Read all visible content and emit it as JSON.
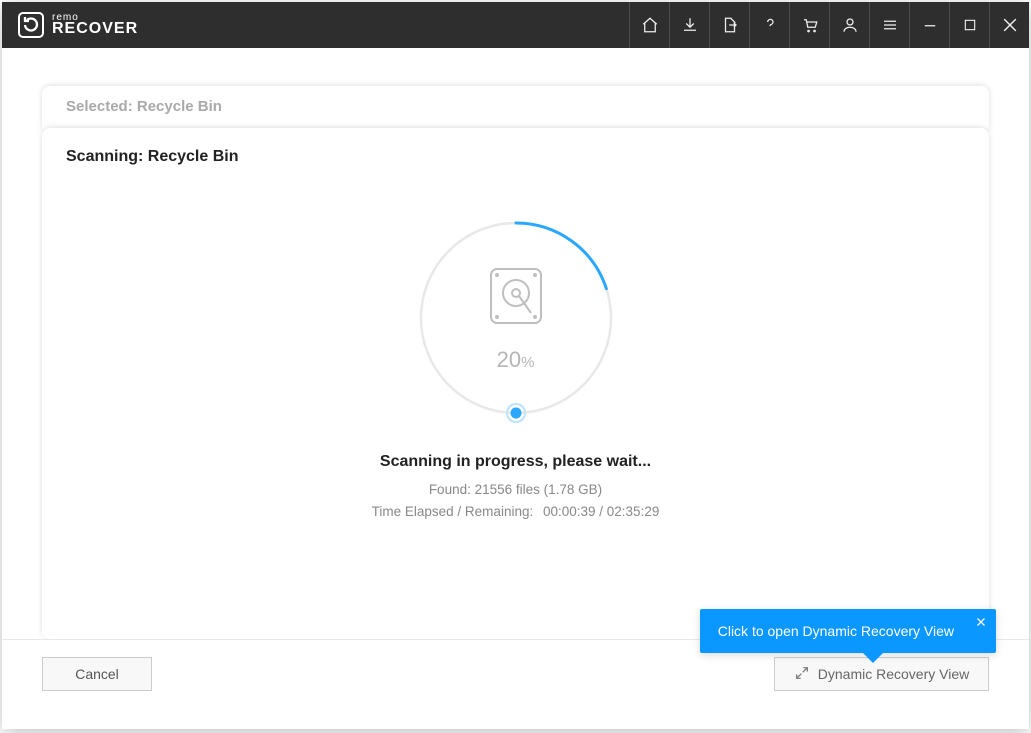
{
  "app": {
    "brand_line1": "remo",
    "brand_line2": "RECOVER"
  },
  "panel": {
    "selected_label": "Selected: Recycle Bin",
    "scanning_label": "Scanning: Recycle Bin"
  },
  "progress": {
    "percent_value": "20",
    "percent_symbol": "%",
    "status_text": "Scanning in progress, please wait...",
    "found_text": "Found: 21556 files (1.78 GB)",
    "time_label": "Time Elapsed / Remaining:",
    "time_value": "00:00:39 / 02:35:29"
  },
  "buttons": {
    "cancel": "Cancel",
    "dynamic_recovery": "Dynamic Recovery View"
  },
  "tooltip": {
    "text": "Click to open Dynamic Recovery View"
  }
}
